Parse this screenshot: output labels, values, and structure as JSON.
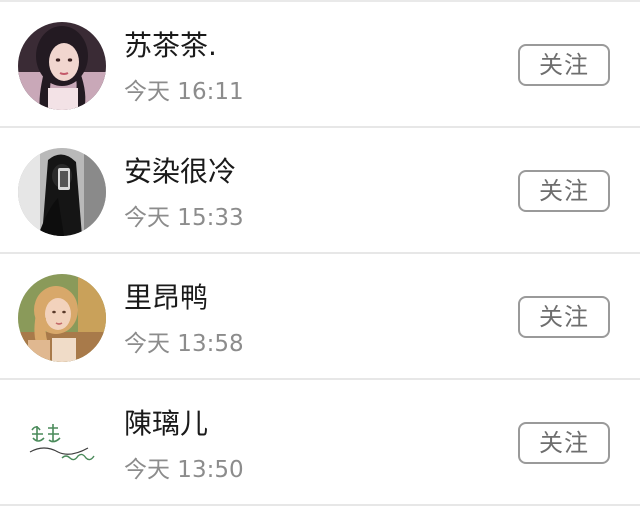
{
  "list": {
    "items": [
      {
        "name": "苏茶茶.",
        "time": "今天 16:11",
        "follow_label": "关注",
        "avatar": "portrait-woman-dark-hair"
      },
      {
        "name": "安染很冷",
        "time": "今天 15:33",
        "follow_label": "关注",
        "avatar": "mirror-selfie-black-white"
      },
      {
        "name": "里昂鸭",
        "time": "今天 13:58",
        "follow_label": "关注",
        "avatar": "portrait-woman-blonde"
      },
      {
        "name": "陳璃儿",
        "time": "今天 13:50",
        "follow_label": "关注",
        "avatar": "handwritten-calligraphy-green"
      }
    ]
  },
  "colors": {
    "name_text": "#1a1a1a",
    "time_text": "#8c8c8c",
    "button_border": "#9a9a9a",
    "button_text": "#6e6e6e",
    "divider": "#e7e7e7",
    "background": "#ffffff"
  }
}
